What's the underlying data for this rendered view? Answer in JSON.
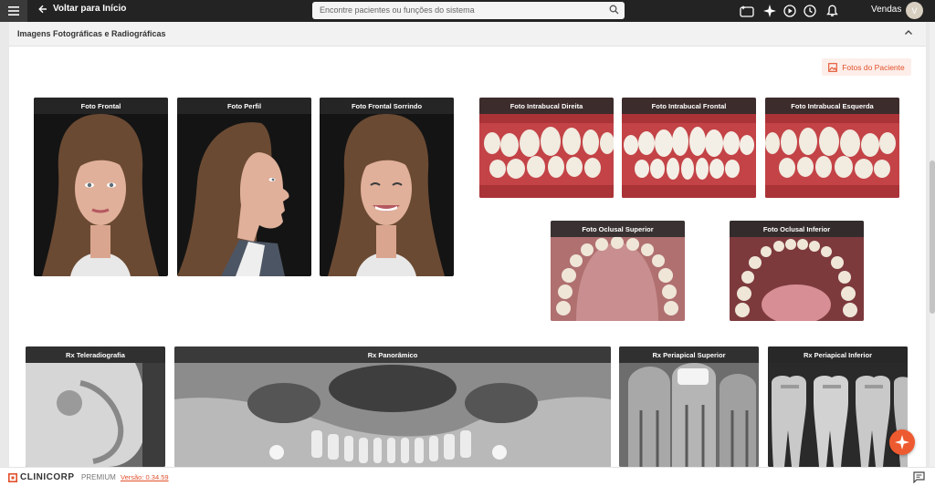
{
  "header": {
    "back_label": "Voltar para Início",
    "search_placeholder": "Encontre pacientes ou funções do sistema",
    "user_name": "Vendas",
    "user_initial": "V"
  },
  "panel": {
    "title": "Imagens Fotográficas e Radiográficas",
    "fotos_button": "Fotos do Paciente"
  },
  "photos": {
    "frontal": "Foto Frontal",
    "perfil": "Foto Perfil",
    "sorrindo": "Foto Frontal Sorrindo",
    "intra_direita": "Foto Intrabucal Direita",
    "intra_frontal": "Foto Intrabucal Frontal",
    "intra_esquerda": "Foto Intrabucal Esquerda",
    "oclusal_superior": "Foto Oclusal Superior",
    "oclusal_inferior": "Foto Oclusal Inferior"
  },
  "radiographs": {
    "tele": "Rx Teleradiografia",
    "panoramico": "Rx Panorâmico",
    "periapical_superior": "Rx Periapical Superior",
    "periapical_inferior": "Rx Periapical Inferior"
  },
  "footer": {
    "brand": "CLINICORP",
    "plan": "PREMIUM",
    "version": "Versão: 0.34.59"
  },
  "icons": [
    "menu-icon",
    "arrow-left-icon",
    "search-icon",
    "chat-sparkle-icon",
    "sparkle-icon",
    "play-icon",
    "clock-icon",
    "bell-icon",
    "chevron-up-icon",
    "image-icon",
    "message-icon",
    "fab-sparkle-icon"
  ],
  "colors": {
    "accent": "#e2502c",
    "topbar": "#232323"
  }
}
